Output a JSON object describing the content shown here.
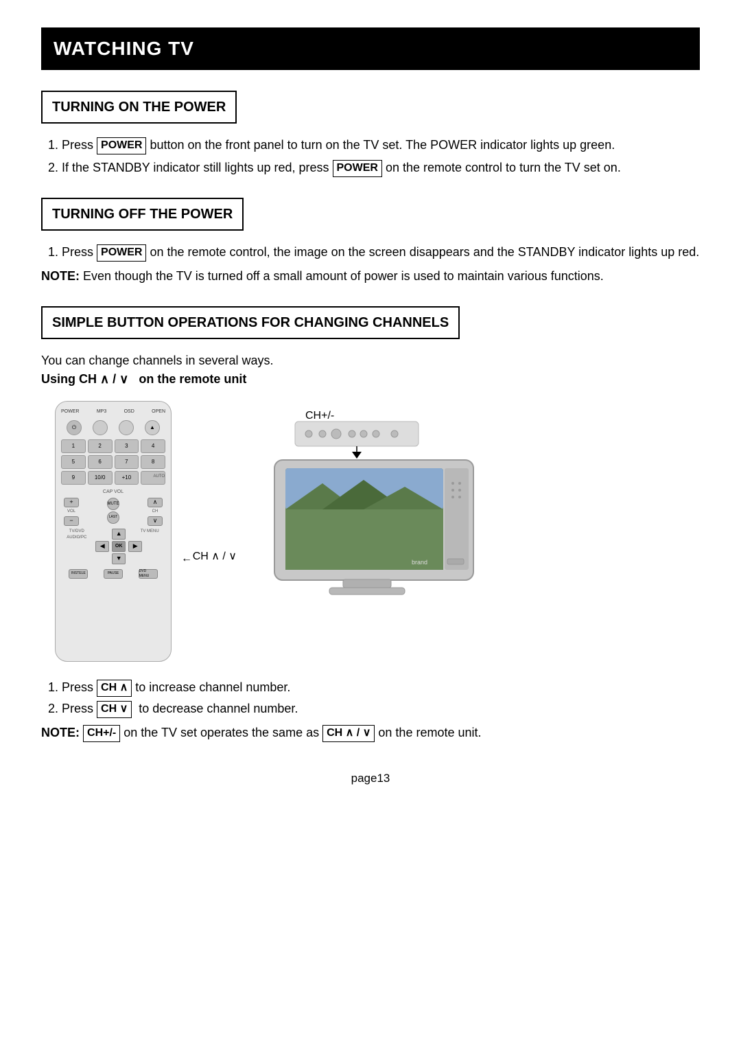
{
  "page": {
    "title": "WATCHING TV",
    "section1": {
      "header": "TURNING ON THE POWER",
      "items": [
        "Press [POWER] button on the front panel to turn on the TV set. The POWER indicator lights up green.",
        "If the STANDBY indicator still lights up red, press [POWER] on the remote control to turn the TV set on."
      ]
    },
    "section2": {
      "header": "TURNING OFF THE POWER",
      "items": [
        "Press [POWER] on the remote control, the image on the screen disappears and the STANDBY indicator lights up red."
      ],
      "note": "NOTE: Even though the TV is turned off a small amount of power is used to maintain various functions."
    },
    "section3": {
      "header": "SIMPLE BUTTON OPERATIONS FOR CHANGING CHANNELS",
      "intro": "You can change channels in several ways.",
      "using_ch_label": "Using CH ∧ / ∨  on the remote unit",
      "ch_label": "CH ∧ / ∨",
      "ch_plus_label": "CH+/-",
      "bottom_notes": [
        "Press [CH∧] to increase channel number.",
        "Press [CH∨] to decrease channel number."
      ],
      "note": "NOTE: [CH+/-] on the TV set operates the same as [CH∧/∨] on the remote unit."
    },
    "page_number": "page13"
  }
}
